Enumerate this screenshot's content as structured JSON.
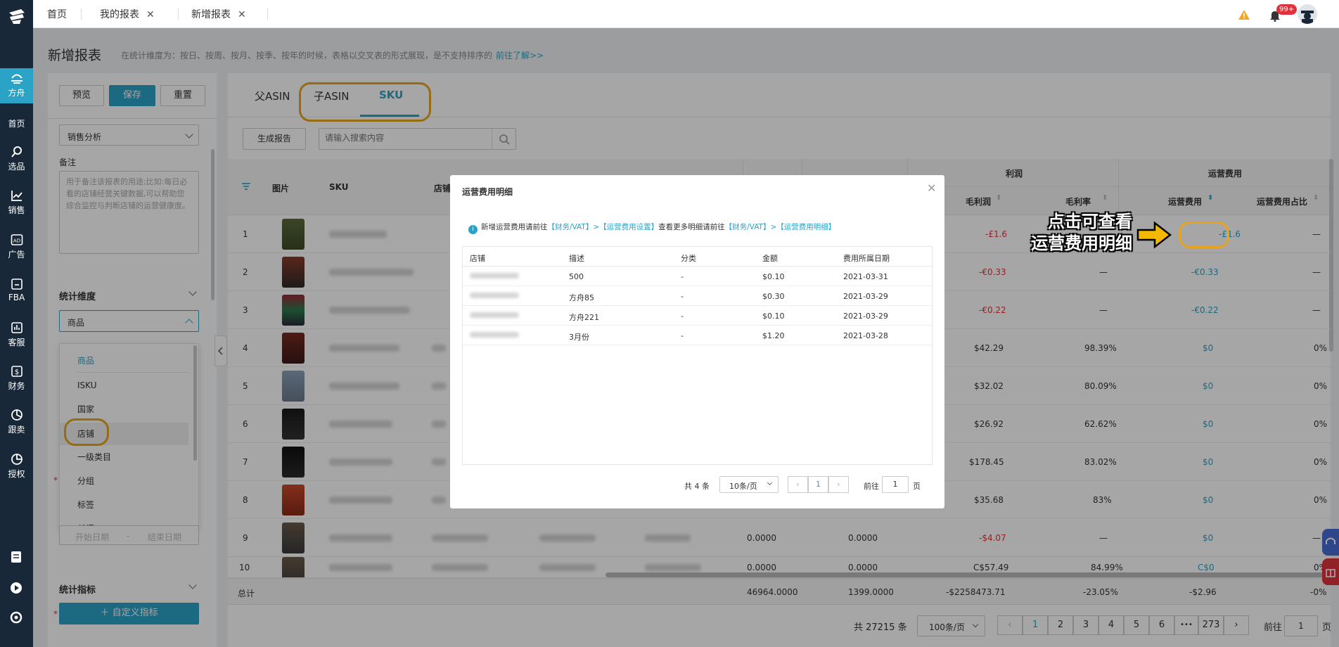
{
  "sidebar": {
    "active": "方舟",
    "items": [
      "方舟",
      "首页",
      "选品",
      "销售",
      "广告",
      "FBA",
      "客服",
      "财务",
      "跟卖",
      "授权"
    ]
  },
  "tabs": [
    {
      "label": "首页"
    },
    {
      "label": "我的报表",
      "closable": "✕"
    },
    {
      "label": "新增报表",
      "closable": "✕"
    }
  ],
  "header": {
    "notif_badge": "99+"
  },
  "page": {
    "title": "新增报表",
    "desc": "在统计维度为：按日、按周、按月、按季、按年的时候，表格以交叉表的形式展现，是不支持排序的",
    "link": "前往了解>>"
  },
  "left": {
    "btn_preview": "预览",
    "btn_save": "保存",
    "btn_reset": "重置",
    "report_type": "销售分析",
    "remark_label": "备注",
    "remark_placeholder": "用于备注该报表的用途;比如:每日必看的店铺经营关键数据,可以帮助您综合监控与判断店铺的运营健康度。",
    "dim_title": "统计维度",
    "dim_value": "商品",
    "dim_options": [
      "商品",
      "ISKU",
      "国家",
      "店铺",
      "一级类目",
      "分组",
      "标签",
      "部门"
    ],
    "date_start": "开始日期",
    "date_sep": "-",
    "date_end": "结束日期",
    "metric_title": "统计指标",
    "btn_custom_metric": "自定义指标"
  },
  "main": {
    "tabs": [
      "父ASIN",
      "子ASIN",
      "SKU"
    ],
    "active_tab": "SKU",
    "btn_generate": "生成报告",
    "search_placeholder": "请输入搜索内容",
    "group_profit": "利润",
    "group_opex": "运营费用",
    "col_image": "图片",
    "col_sku": "SKU",
    "col_store": "店铺",
    "col_gross_profit": "毛利润",
    "col_gross_margin": "毛利率",
    "col_opex": "运营费用",
    "col_opex_ratio": "运营费用占比",
    "rows": [
      {
        "no": "1",
        "profit": "-£1.6",
        "margin": "",
        "opex": "-£1.6",
        "ratio": "—"
      },
      {
        "no": "2",
        "profit": "-€0.33",
        "margin": "—",
        "opex": "-€0.33",
        "ratio": "—"
      },
      {
        "no": "3",
        "profit": "-€0.22",
        "margin": "—",
        "opex": "-€0.22",
        "ratio": "—"
      },
      {
        "no": "4",
        "profit": "$42.29",
        "margin": "98.39%",
        "opex": "$0",
        "ratio": "0%"
      },
      {
        "no": "5",
        "profit": "$32.02",
        "margin": "80.09%",
        "opex": "$0",
        "ratio": "0%"
      },
      {
        "no": "6",
        "profit": "$26.92",
        "margin": "62.62%",
        "opex": "$0",
        "ratio": "0%"
      },
      {
        "no": "7",
        "profit": "$178.45",
        "margin": "83.02%",
        "opex": "$0",
        "ratio": "0%"
      },
      {
        "no": "8",
        "profit": "$35.68",
        "margin": "83%",
        "opex": "$0",
        "ratio": "0%"
      },
      {
        "no": "9",
        "c1": "0.0000",
        "c2": "0.0000",
        "profit": "-$4.07",
        "margin": "—",
        "opex": "$0",
        "ratio": "—"
      },
      {
        "no": "10",
        "c1": "0.0000",
        "c2": "0.0000",
        "profit": "C$57.49",
        "margin": "84.99%",
        "opex": "C$0",
        "ratio": "0%"
      }
    ],
    "total": {
      "label": "总计",
      "c1": "46964.0000",
      "c2": "1399.0000",
      "profit": "-$2258473.71",
      "margin": "-23.05%",
      "opex": "-$2.96",
      "ratio": "-0%"
    },
    "pagination": {
      "total": "共 27215 条",
      "size": "100条/页",
      "pages": [
        "1",
        "2",
        "3",
        "4",
        "5",
        "6",
        "•••",
        "273"
      ],
      "goto_prefix": "前往",
      "goto_value": "1",
      "goto_suffix": "页"
    }
  },
  "modal": {
    "title": "运营费用明细",
    "notice_prefix": "新增运营费用请前往",
    "notice_link1": "【财务/VAT】>【运营费用设置】",
    "notice_mid": "查看更多明细请前往",
    "notice_link2": "【财务/VAT】>【运营费用明细】",
    "columns": [
      "店铺",
      "描述",
      "分类",
      "金额",
      "费用所属日期"
    ],
    "rows": [
      {
        "desc": "500",
        "cat": "-",
        "amount": "$0.10",
        "date": "2021-03-31"
      },
      {
        "desc": "方舟85",
        "cat": "-",
        "amount": "$0.30",
        "date": "2021-03-29"
      },
      {
        "desc": "方舟221",
        "cat": "-",
        "amount": "$0.10",
        "date": "2021-03-29"
      },
      {
        "desc": "3月份",
        "cat": "-",
        "amount": "$1.20",
        "date": "2021-03-28"
      }
    ],
    "pagination": {
      "total": "共 4 条",
      "size": "10条/页",
      "page": "1",
      "goto_prefix": "前往",
      "goto_value": "1",
      "goto_suffix": "页"
    }
  },
  "annotation": {
    "line1": "点击可查看",
    "line2": "运营费用明细"
  },
  "colors": {
    "accent": "#2aa3c6",
    "sidebar": "#182838",
    "negative": "#e0323c",
    "highlight": "#e8a51c",
    "annotation_arrow": "#f5b800"
  }
}
